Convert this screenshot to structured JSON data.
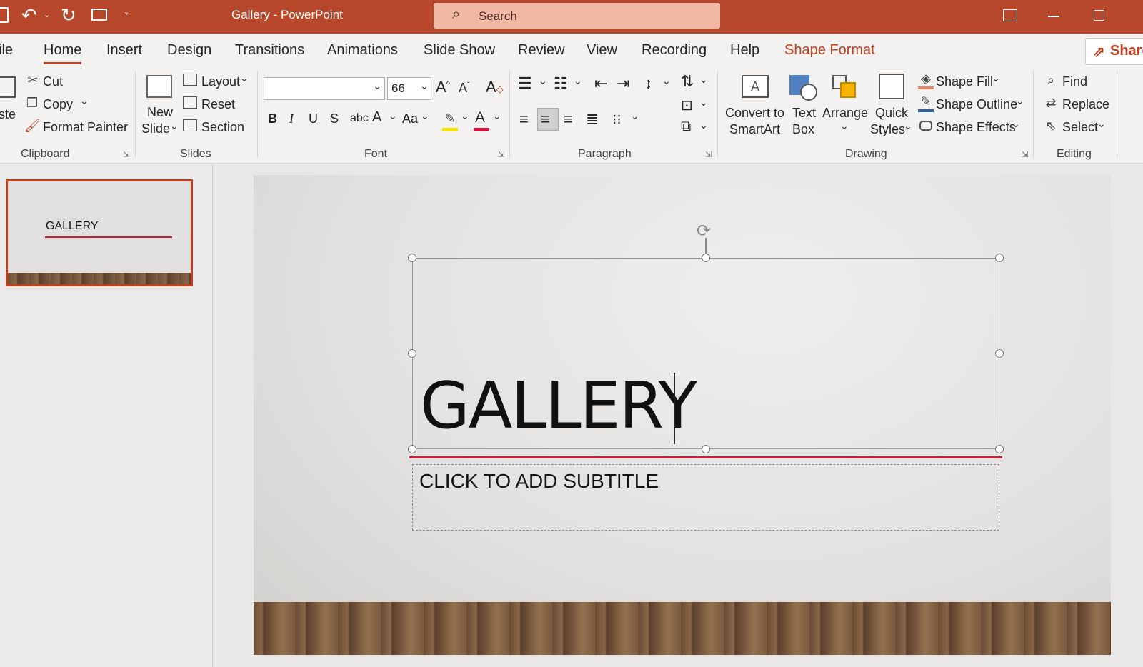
{
  "window": {
    "title": "Gallery  -  PowerPoint"
  },
  "search": {
    "placeholder": "Search"
  },
  "tabs": [
    "ile",
    "Home",
    "Insert",
    "Design",
    "Transitions",
    "Animations",
    "Slide Show",
    "Review",
    "View",
    "Recording",
    "Help",
    "Shape Format"
  ],
  "share_label": "Share",
  "clipboard": {
    "paste": "ste",
    "cut": "Cut",
    "copy": "Copy",
    "format_painter": "Format Painter",
    "group": "Clipboard"
  },
  "slides_group": {
    "new_slide_1": "New",
    "new_slide_2": "Slide",
    "layout": "Layout",
    "reset": "Reset",
    "section": "Section",
    "group": "Slides"
  },
  "font": {
    "name": "",
    "size": "66",
    "group": "Font",
    "change_case": "Aa",
    "highlight_color": "#f5e100",
    "font_color": "#d3143c"
  },
  "paragraph": {
    "group": "Paragraph"
  },
  "drawing": {
    "convert_1": "Convert to",
    "convert_2": "SmartArt",
    "textbox_1": "Text",
    "textbox_2": "Box",
    "arrange": "Arrange",
    "quick_1": "Quick",
    "quick_2": "Styles",
    "shape_fill": "Shape Fill",
    "shape_outline": "Shape Outline",
    "shape_effects": "Shape Effects",
    "group": "Drawing"
  },
  "editing": {
    "find": "Find",
    "replace": "Replace",
    "select": "Select",
    "group": "Editing"
  },
  "thumbnail": {
    "title": "GALLERY"
  },
  "slide": {
    "title": "GALLERY",
    "subtitle": "CLICK TO ADD SUBTITLE"
  },
  "colors": {
    "brand": "#b7472a",
    "accent_line": "#c81e3c"
  }
}
